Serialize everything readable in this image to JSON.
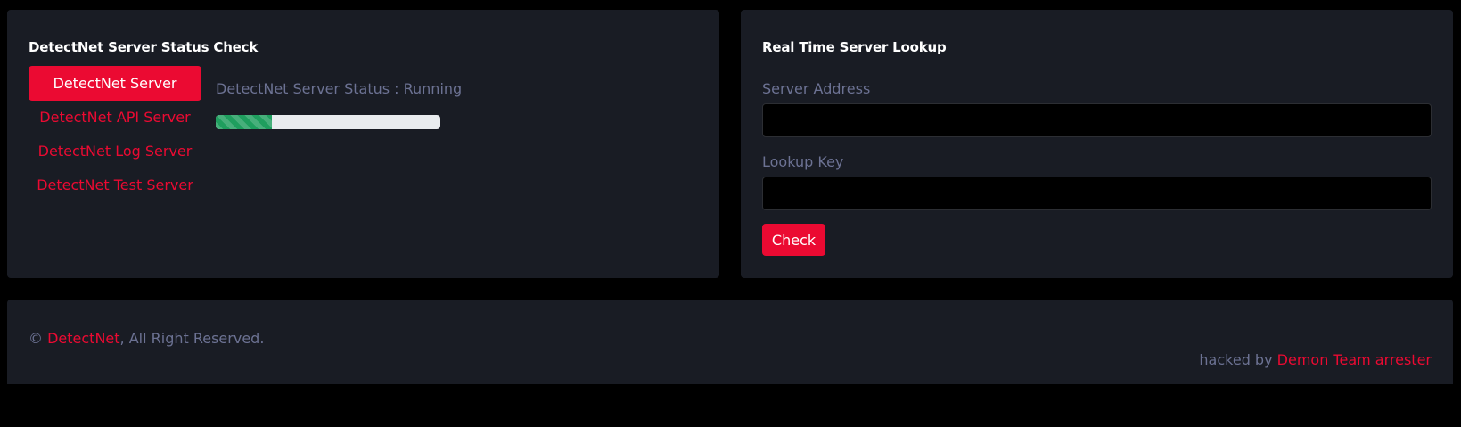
{
  "status_panel": {
    "title": "DetectNet Server Status Check",
    "servers": [
      {
        "label": "DetectNet Server",
        "active": true
      },
      {
        "label": "DetectNet API Server",
        "active": false
      },
      {
        "label": "DetectNet Log Server",
        "active": false
      },
      {
        "label": "DetectNet Test Server",
        "active": false
      }
    ],
    "status_text": "DetectNet Server Status : Running",
    "progress_percent": 25
  },
  "lookup_panel": {
    "title": "Real Time Server Lookup",
    "server_address_label": "Server Address",
    "server_address_value": "",
    "lookup_key_label": "Lookup Key",
    "lookup_key_value": "",
    "check_label": "Check"
  },
  "footer": {
    "copyright_symbol": "©",
    "brand": "DetectNet",
    "rights_text": ", All Right Reserved.",
    "hacked_prefix": "hacked by",
    "hacker_name": "Demon Team arrester"
  },
  "colors": {
    "background": "#000000",
    "panel": "#191c24",
    "accent": "#eb0a32",
    "muted_text": "#6c7293",
    "progress_fill": "#1f9e5e",
    "progress_track": "#e9ecef"
  }
}
